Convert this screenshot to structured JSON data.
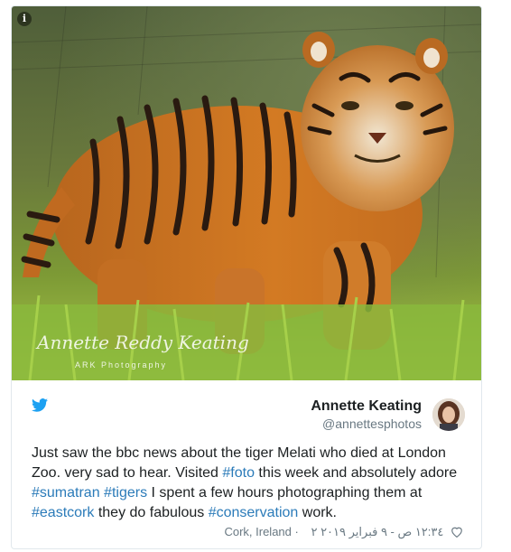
{
  "photo": {
    "watermark_signature": "Annette Reddy Keating",
    "watermark_subtitle": "ARK Photography",
    "info_icon": "info-icon"
  },
  "tweet": {
    "source_icon": "twitter-bird-icon",
    "author_name": "Annette Keating",
    "author_handle": "@annettesphotos",
    "text_segments": [
      {
        "t": "Just saw the bbc news about the tiger Melati who died at London Zoo. very sad to hear. Visited ",
        "tag": false
      },
      {
        "t": "#foto",
        "tag": true
      },
      {
        "t": " this week and absolutely adore ",
        "tag": false
      },
      {
        "t": "#sumatran",
        "tag": true
      },
      {
        "t": " ",
        "tag": false
      },
      {
        "t": "#tigers",
        "tag": true
      },
      {
        "t": " I spent a few hours photographing them at ",
        "tag": false
      },
      {
        "t": "#eastcork",
        "tag": true
      },
      {
        "t": " they do fabulous ",
        "tag": false
      },
      {
        "t": "#conservation",
        "tag": true
      },
      {
        "t": " work.",
        "tag": false
      }
    ],
    "location": "Cork, Ireland",
    "datetime": "١٢:٣٤ ص - ٩ فبراير ٢٠١٩",
    "like_count": "٢",
    "like_icon": "heart-icon",
    "accent_color": "#2b7bb9",
    "twitter_blue": "#1da1f2"
  }
}
